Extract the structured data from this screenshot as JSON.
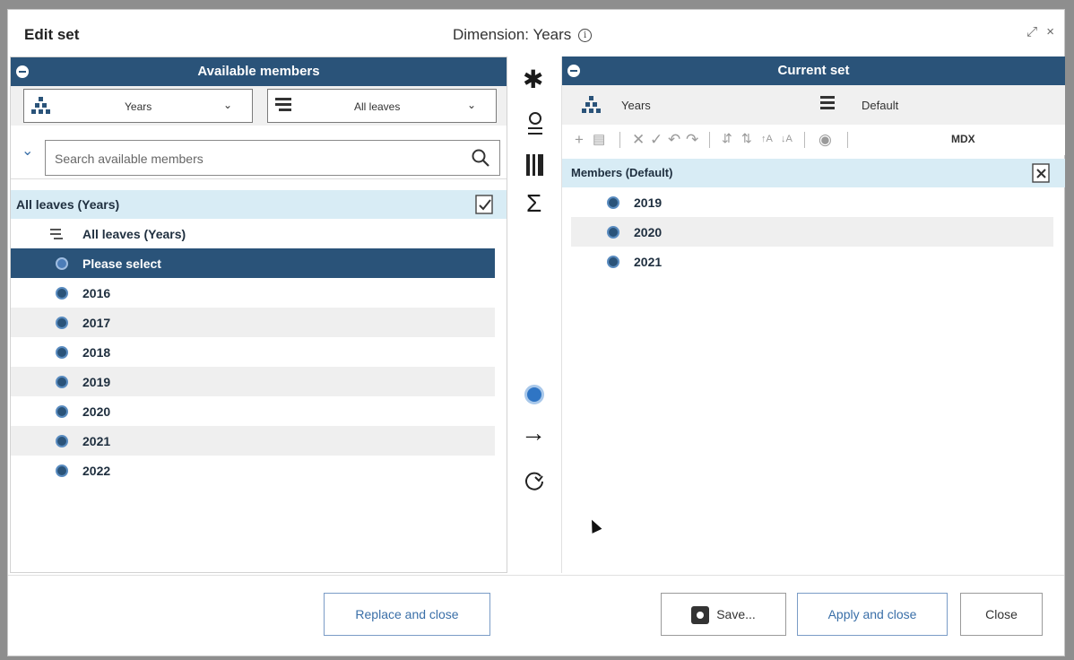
{
  "dialog": {
    "title": "Edit set",
    "dimension_label": "Dimension: Years",
    "window_controls": "⤢ ×"
  },
  "left_panel": {
    "header": "Available members",
    "hierarchy_dropdown": "Years",
    "level_dropdown": "All leaves",
    "search_placeholder": "Search available members",
    "list_header": "All leaves (Years)",
    "items": [
      {
        "label": "All leaves (Years)",
        "type": "level"
      },
      {
        "label": "Please select",
        "type": "member",
        "selected": true
      },
      {
        "label": "2016",
        "type": "member"
      },
      {
        "label": "2017",
        "type": "member"
      },
      {
        "label": "2018",
        "type": "member"
      },
      {
        "label": "2019",
        "type": "member"
      },
      {
        "label": "2020",
        "type": "member"
      },
      {
        "label": "2021",
        "type": "member"
      },
      {
        "label": "2022",
        "type": "member"
      }
    ]
  },
  "right_panel": {
    "header": "Current set",
    "hierarchy": "Years",
    "set_name": "Default",
    "mdx_label": "MDX",
    "list_header": "Members (Default)",
    "items": [
      {
        "label": "2019"
      },
      {
        "label": "2020"
      },
      {
        "label": "2021"
      }
    ]
  },
  "footer": {
    "replace_close": "Replace and close",
    "save": "Save...",
    "apply_close": "Apply and close",
    "close": "Close"
  },
  "colors": {
    "header_bg": "#2a5379",
    "list_header_bg": "#d8ecf5",
    "selected_row": "#2a5379",
    "accent_blue": "#3a6fa8"
  }
}
